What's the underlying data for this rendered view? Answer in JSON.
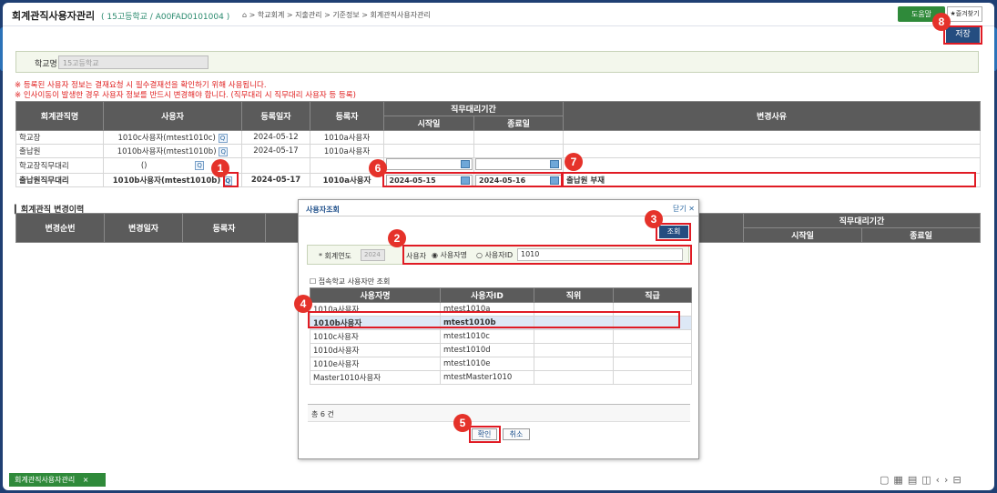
{
  "header": {
    "title": "회계관직사용자관리",
    "subtitle": "( 15고등학교 / A00FAD0101004 )",
    "breadcrumb": "⌂ > 학교회계 > 지출관리 > 기준정보 > 회계관직사용자관리",
    "help_label": "도움말",
    "favorite_label": "★즐겨찾기",
    "save_label": "저장"
  },
  "school": {
    "label": "학교명",
    "value": "15고등학교"
  },
  "notices": [
    "※ 등록된 사용자 정보는 결재요청 시 필수결재선을 확인하기 위해 사용됩니다.",
    "※ 인사이동이 발생한 경우 사용자 정보를 반드시 변경해야 합니다. (직무대리 시 직무대리 사용자 등 등록)"
  ],
  "main_table": {
    "headers": {
      "role": "회계관직명",
      "user": "사용자",
      "reg_date": "등록일자",
      "registrant": "등록자",
      "proxy_period": "직무대리기간",
      "start": "시작일",
      "end": "종료일",
      "reason": "변경사유"
    },
    "rows": [
      {
        "role": "학교장",
        "user": "1010c사용자(mtest1010c)",
        "reg_date": "2024-05-12",
        "registrant": "1010a사용자",
        "start": "",
        "end": "",
        "reason": ""
      },
      {
        "role": "출납원",
        "user": "1010b사용자(mtest1010b)",
        "reg_date": "2024-05-17",
        "registrant": "1010a사용자",
        "start": "",
        "end": "",
        "reason": ""
      },
      {
        "role": "학교장직무대리",
        "user": "()",
        "reg_date": "",
        "registrant": "",
        "start": "",
        "end": "",
        "reason": ""
      },
      {
        "role": "출납원직무대리",
        "user": "1010b사용자(mtest1010b)",
        "reg_date": "2024-05-17",
        "registrant": "1010a사용자",
        "start": "2024-05-15",
        "end": "2024-05-16",
        "reason": "출납원 부재"
      }
    ]
  },
  "history": {
    "title": "회계관직 변경이력",
    "headers": {
      "seq": "변경순번",
      "date": "변경일자",
      "registrant": "등록자",
      "period": "직무대리기간",
      "start": "시작일",
      "end": "종료일"
    }
  },
  "modal": {
    "title": "사용자조회",
    "close_label": "닫기 ✕",
    "query_label": "조회",
    "year_label": "* 회계연도",
    "year_value": "2024",
    "user_label": "사용자",
    "radio_name": "사용자명",
    "radio_id": "사용자ID",
    "search_value": "1010",
    "checkbox_label": "접속학교 사용자만 조회",
    "columns": [
      "사용자명",
      "사용자ID",
      "직위",
      "직급"
    ],
    "rows": [
      {
        "name": "1010a사용자",
        "id": "mtest1010a"
      },
      {
        "name": "1010b사용자",
        "id": "mtest1010b"
      },
      {
        "name": "1010c사용자",
        "id": "mtest1010c"
      },
      {
        "name": "1010d사용자",
        "id": "mtest1010d"
      },
      {
        "name": "1010e사용자",
        "id": "mtest1010e"
      },
      {
        "name": "Master1010사용자",
        "id": "mtestMaster1010"
      }
    ],
    "total": "총 6 건",
    "confirm_label": "확인",
    "cancel_label": "취소"
  },
  "badges": [
    "1",
    "2",
    "3",
    "4",
    "5",
    "6",
    "7",
    "8"
  ],
  "bottom": {
    "tab_label": "회계관직사용자관리",
    "tab_close": "×"
  },
  "colors": {
    "accent": "#244d80",
    "highlight": "#e01b24",
    "green": "#2f8a3a",
    "header_gray": "#5b5b5b"
  }
}
